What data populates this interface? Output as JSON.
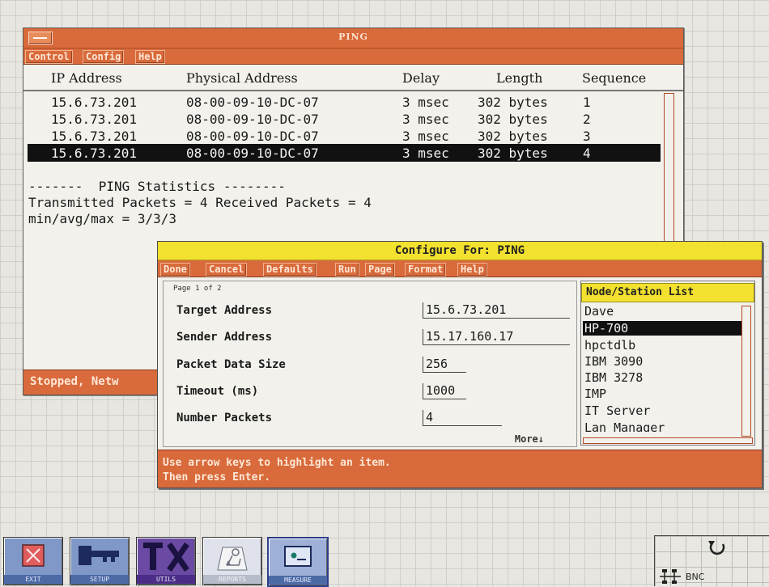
{
  "ping_window": {
    "title": "PING",
    "menu": [
      "Control",
      "Config",
      "Help"
    ],
    "columns": [
      "IP Address",
      "Physical Address",
      "Delay",
      "Length",
      "Sequence"
    ],
    "rows": [
      {
        "ip": "15.6.73.201",
        "mac": "08-00-09-10-DC-07",
        "delay": "3 msec",
        "length": "302 bytes",
        "seq": "1"
      },
      {
        "ip": "15.6.73.201",
        "mac": "08-00-09-10-DC-07",
        "delay": "3 msec",
        "length": "302 bytes",
        "seq": "2"
      },
      {
        "ip": "15.6.73.201",
        "mac": "08-00-09-10-DC-07",
        "delay": "3 msec",
        "length": "302 bytes",
        "seq": "3"
      },
      {
        "ip": "15.6.73.201",
        "mac": "08-00-09-10-DC-07",
        "delay": "3 msec",
        "length": "302 bytes",
        "seq": "4"
      }
    ],
    "selected_row": 3,
    "stats_header": "-------  PING Statistics --------",
    "stats_line1": "Transmitted Packets = 4 Received Packets = 4",
    "stats_line2": "min/avg/max = 3/3/3",
    "status": "Stopped, Netw"
  },
  "configure_dialog": {
    "title": "Configure For: PING",
    "menu": [
      "Done",
      "Cancel",
      "Defaults",
      "Run",
      "Page",
      "Format",
      "Help"
    ],
    "page_indicator": "Page 1 of 2",
    "fields": [
      {
        "label": "Target Address",
        "value": "15.6.73.201"
      },
      {
        "label": "Sender Address",
        "value": "15.17.160.17"
      },
      {
        "label": "Packet Data Size",
        "value": "256"
      },
      {
        "label": "Timeout (ms)",
        "value": "1000"
      },
      {
        "label": "Number Packets",
        "value": "4"
      }
    ],
    "more_label": "More↓",
    "list_title": "Node/Station List",
    "list_items": [
      "Dave",
      "HP-700",
      "hpctdlb",
      "IBM 3090",
      "IBM 3278",
      "IMP",
      "IT Server",
      "Lan Manager"
    ],
    "list_selected": 1,
    "help_line1": "Use arrow keys to highlight an item.",
    "help_line2": "Then press Enter."
  },
  "toolbar": {
    "tools": [
      {
        "icon": "exit-icon",
        "label": "EXIT"
      },
      {
        "icon": "key-icon",
        "label": "SETUP"
      },
      {
        "icon": "tools-icon",
        "label": "UTILS"
      },
      {
        "icon": "reports-icon",
        "label": "REPORTS"
      },
      {
        "icon": "measure-icon",
        "label": "MEASURE"
      }
    ]
  },
  "network_widget": {
    "label": "BNC",
    "icons": [
      "network-topology-icon",
      "refresh-icon"
    ]
  },
  "colors": {
    "window_accent": "#d96a3b",
    "dialog_title": "#f2e12e",
    "selection": "#111111",
    "desktop": "#e7e6e0"
  }
}
